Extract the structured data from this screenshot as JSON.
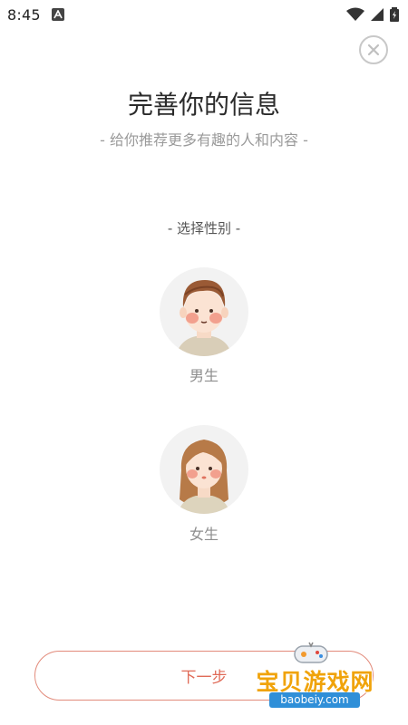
{
  "status_bar": {
    "time": "8:45",
    "app_icon": "a-icon",
    "icons": [
      "wifi-icon",
      "signal-icon",
      "battery-icon"
    ]
  },
  "close_icon": "close-icon",
  "header": {
    "title": "完善你的信息",
    "subtitle": "- 给你推荐更多有趣的人和内容 -"
  },
  "gender": {
    "label": "- 选择性别 -",
    "options": [
      {
        "label": "男生",
        "icon": "male-avatar-icon"
      },
      {
        "label": "女生",
        "icon": "female-avatar-icon"
      }
    ]
  },
  "next_button": {
    "label": "下一步",
    "color": "#e06b58"
  },
  "watermark": {
    "text": "宝贝游戏网",
    "url": "baobeiy.com"
  }
}
